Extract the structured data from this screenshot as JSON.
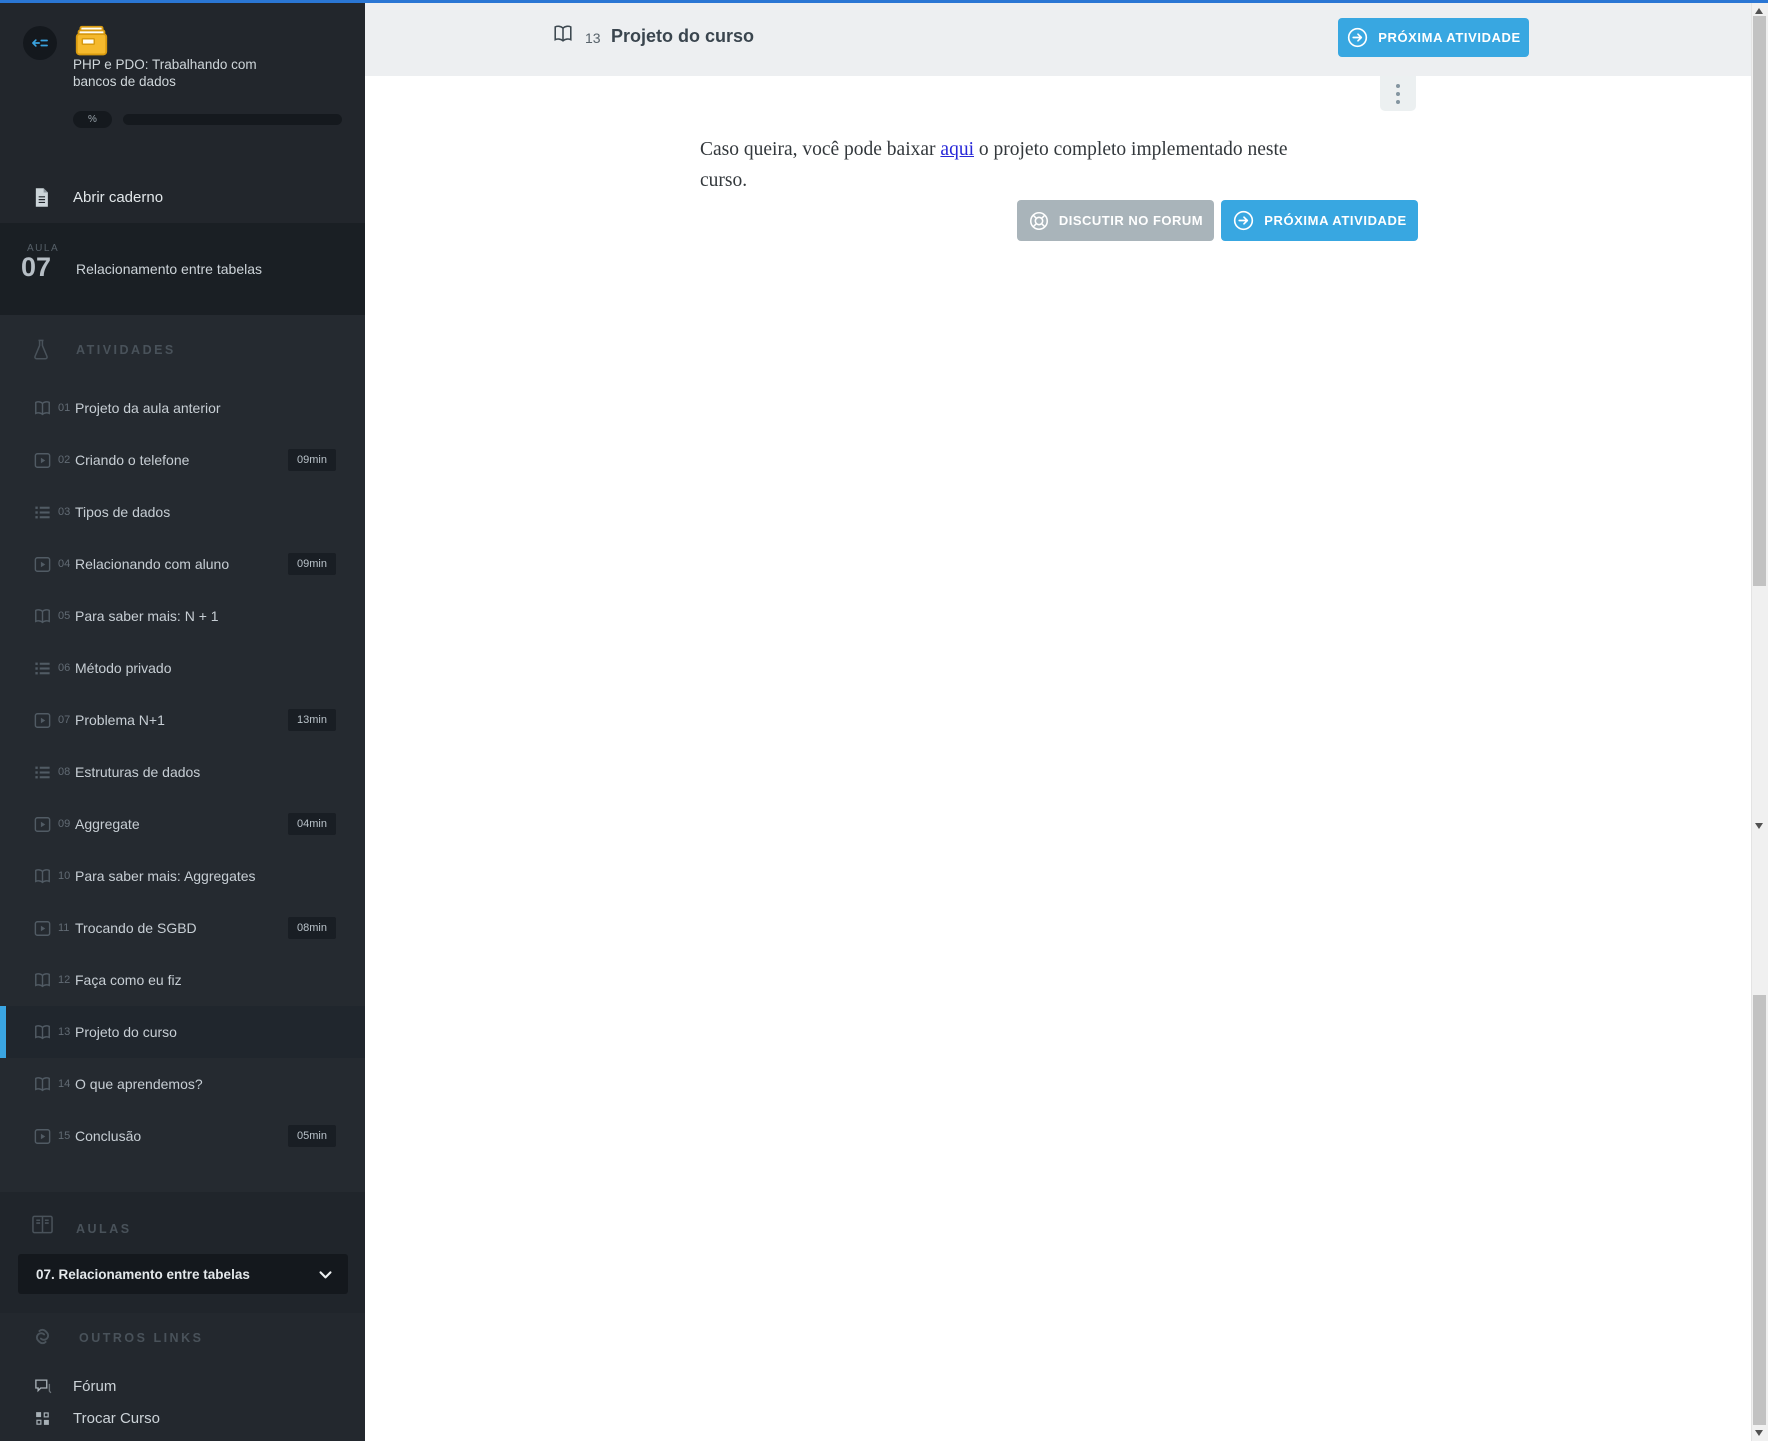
{
  "colors": {
    "topbar_blue": "#2a76d4",
    "accent_blue": "#38a7e1",
    "selected_accent": "#3aa5e2",
    "sidebar_bg": "#252a30",
    "header_bg": "#edeff1",
    "forum_button_gray": "#a9b4ba",
    "link_blue": "#2727d8",
    "logo_yellow": "#f5b92d"
  },
  "icons": {
    "toggle": "collapse-sidebar-arrow-left",
    "logo": "yellow-card-catalog",
    "notebook": "document-page",
    "activities_header": "flask",
    "book": "open-book",
    "video": "play-video",
    "list": "bullet-list",
    "aulas_header": "book-spread",
    "outros_header": "chain-links",
    "forum": "chat-bubble",
    "trocar": "grid-squares",
    "next": "circle-arrow-right",
    "discuss": "life-buoy",
    "dropdown": "chevron-down",
    "more": "kebab-dots"
  },
  "sidebar": {
    "course": {
      "title_line1": "PHP e PDO: Trabalhando com",
      "title_line2": "bancos de dados",
      "progress_label": "%"
    },
    "open_notebook": {
      "label": "Abrir caderno"
    },
    "current_lesson": {
      "kicker": "AULA",
      "number": "07",
      "title": "Relacionamento entre tabelas"
    },
    "activities": {
      "header": "ATIVIDADES",
      "items": [
        {
          "num": "01",
          "label": "Projeto da aula anterior",
          "type": "book"
        },
        {
          "num": "02",
          "label": "Criando o telefone",
          "type": "video",
          "duration": "09min"
        },
        {
          "num": "03",
          "label": "Tipos de dados",
          "type": "list"
        },
        {
          "num": "04",
          "label": "Relacionando com aluno",
          "type": "video",
          "duration": "09min"
        },
        {
          "num": "05",
          "label": "Para saber mais: N + 1",
          "type": "book"
        },
        {
          "num": "06",
          "label": "Método privado",
          "type": "list"
        },
        {
          "num": "07",
          "label": "Problema N+1",
          "type": "video",
          "duration": "13min"
        },
        {
          "num": "08",
          "label": "Estruturas de dados",
          "type": "list"
        },
        {
          "num": "09",
          "label": "Aggregate",
          "type": "video",
          "duration": "04min"
        },
        {
          "num": "10",
          "label": "Para saber mais: Aggregates",
          "type": "book"
        },
        {
          "num": "11",
          "label": "Trocando de SGBD",
          "type": "video",
          "duration": "08min"
        },
        {
          "num": "12",
          "label": "Faça como eu fiz",
          "type": "book"
        },
        {
          "num": "13",
          "label": "Projeto do curso",
          "type": "book",
          "selected": true
        },
        {
          "num": "14",
          "label": "O que aprendemos?",
          "type": "book"
        },
        {
          "num": "15",
          "label": "Conclusão",
          "type": "video",
          "duration": "05min"
        }
      ]
    },
    "aulas": {
      "header": "AULAS",
      "dropdown_value": "07. Relacionamento entre tabelas"
    },
    "outros_links": {
      "header": "OUTROS LINKS",
      "items": [
        {
          "label": "Fórum"
        },
        {
          "label": "Trocar Curso"
        }
      ]
    }
  },
  "main": {
    "header": {
      "activity_number": "13",
      "title": "Projeto do curso",
      "next_button": "PRÓXIMA ATIVIDADE"
    },
    "paragraph": {
      "text_before": "Caso queira, você pode baixar ",
      "link_text": "aqui",
      "text_after_line1": " o projeto completo implementado neste",
      "text_line2": "curso."
    },
    "actions": {
      "forum_button": "DISCUTIR NO FORUM",
      "next_button": "PRÓXIMA ATIVIDADE"
    }
  }
}
